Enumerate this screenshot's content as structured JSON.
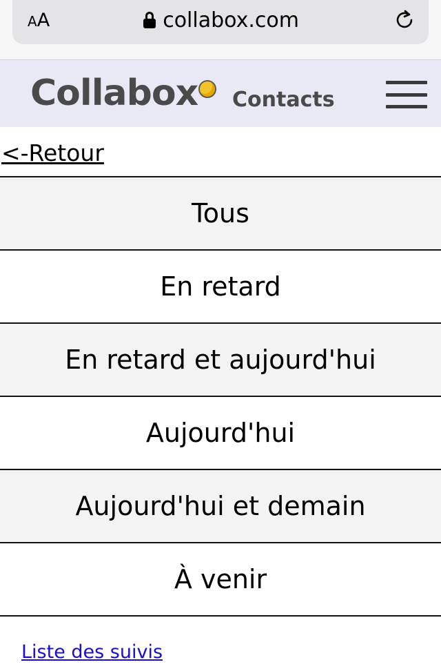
{
  "browser": {
    "text_size_small": "A",
    "text_size_large": "A",
    "url": "collabox.com"
  },
  "header": {
    "logo_text": "Collabox",
    "section_title": "Contacts"
  },
  "nav": {
    "back_label": "<-Retour"
  },
  "filters": [
    {
      "label": "Tous"
    },
    {
      "label": "En retard"
    },
    {
      "label": "En retard et aujourd'hui"
    },
    {
      "label": "Aujourd'hui"
    },
    {
      "label": "Aujourd'hui et demain"
    },
    {
      "label": "À venir"
    }
  ],
  "footer": {
    "link_label": "Liste des suivis"
  },
  "colors": {
    "header_bg": "#e8e9f4",
    "logo_dot": "#f2c22a",
    "link": "#1a0dcc"
  }
}
